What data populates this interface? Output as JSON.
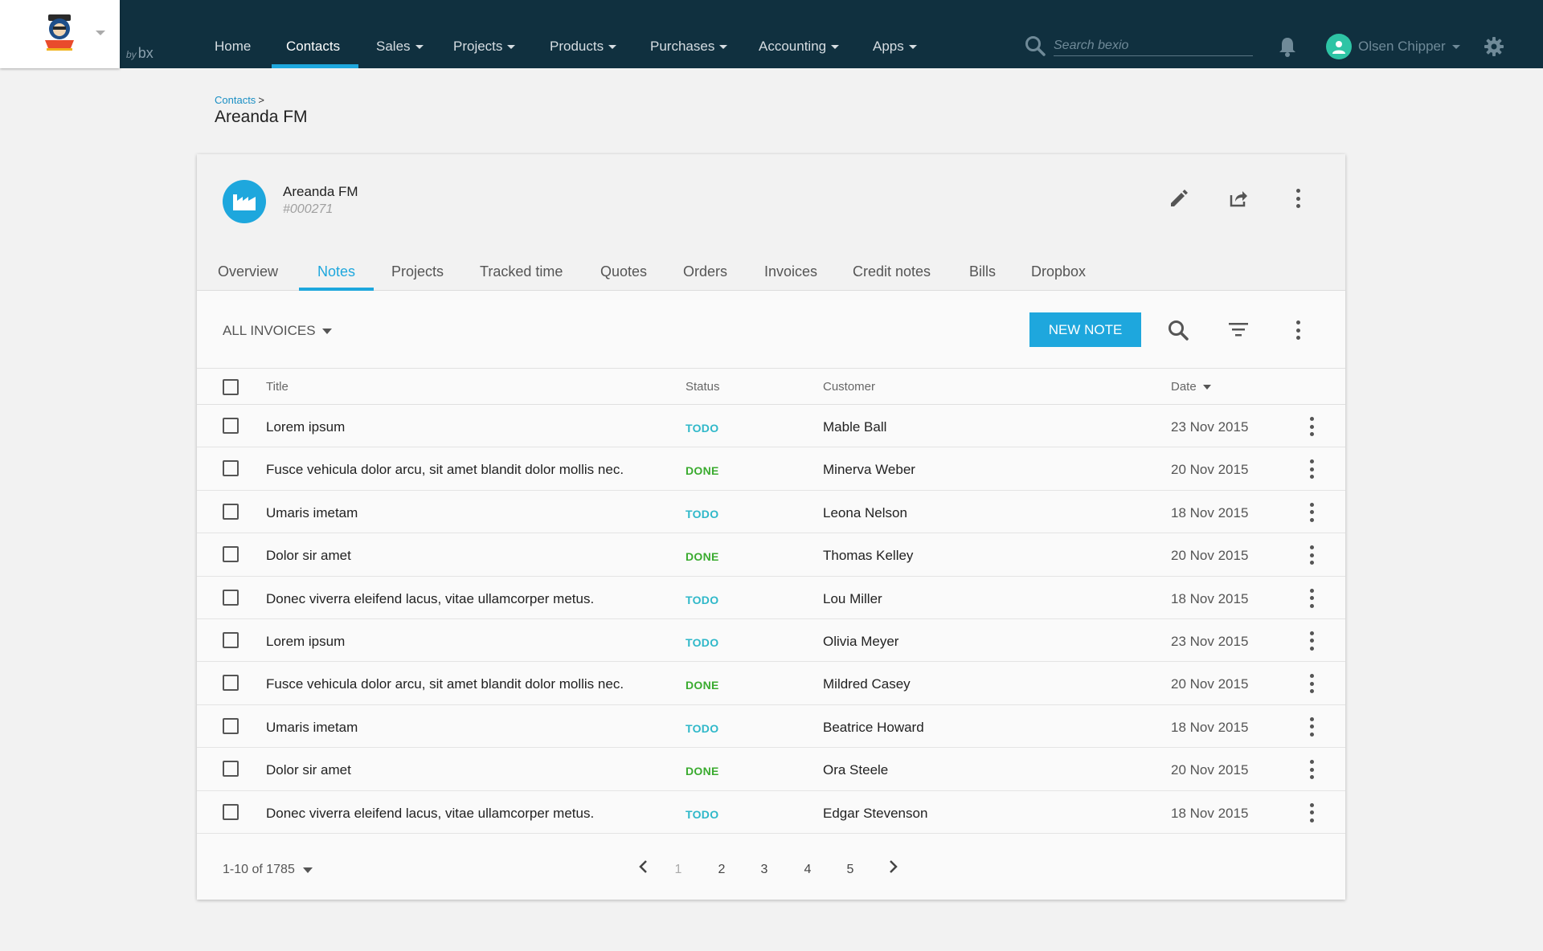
{
  "brand": {
    "by_text": "by",
    "bx_text": "bx"
  },
  "nav": {
    "home": "Home",
    "contacts": "Contacts",
    "sales": "Sales",
    "projects": "Projects",
    "products": "Products",
    "purchases": "Purchases",
    "accounting": "Accounting",
    "apps": "Apps",
    "active": "Contacts"
  },
  "search": {
    "placeholder": "Search bexio",
    "value": ""
  },
  "user": {
    "name": "Olsen Chipper"
  },
  "breadcrumb": {
    "parent": "Contacts",
    "separator": ">"
  },
  "page_title": "Areanda FM",
  "contact": {
    "name": "Areanda FM",
    "id": "#000271"
  },
  "tabs": [
    "Overview",
    "Notes",
    "Projects",
    "Tracked time",
    "Quotes",
    "Orders",
    "Invoices",
    "Credit notes",
    "Bills",
    "Dropbox"
  ],
  "active_tab": "Notes",
  "toolbar": {
    "filter_label": "ALL INVOICES",
    "new_note_label": "NEW NOTE"
  },
  "table": {
    "headers": {
      "title": "Title",
      "status": "Status",
      "customer": "Customer",
      "date": "Date"
    },
    "rows": [
      {
        "title": "Lorem ipsum",
        "status": "TODO",
        "customer": "Mable Ball",
        "date": "23 Nov 2015"
      },
      {
        "title": "Fusce vehicula dolor arcu, sit amet blandit dolor mollis nec.",
        "status": "DONE",
        "customer": "Minerva Weber",
        "date": "20 Nov 2015"
      },
      {
        "title": "Umaris imetam",
        "status": "TODO",
        "customer": "Leona Nelson",
        "date": "18 Nov 2015"
      },
      {
        "title": "Dolor sir amet",
        "status": "DONE",
        "customer": "Thomas Kelley",
        "date": "20 Nov 2015"
      },
      {
        "title": "Donec viverra eleifend lacus, vitae ullamcorper metus.",
        "status": "TODO",
        "customer": "Lou Miller",
        "date": "18 Nov 2015"
      },
      {
        "title": "Lorem ipsum",
        "status": "TODO",
        "customer": "Olivia Meyer",
        "date": "23 Nov 2015"
      },
      {
        "title": "Fusce vehicula dolor arcu, sit amet blandit dolor mollis nec.",
        "status": "DONE",
        "customer": "Mildred Casey",
        "date": "20 Nov 2015"
      },
      {
        "title": "Umaris imetam",
        "status": "TODO",
        "customer": "Beatrice Howard",
        "date": "18 Nov 2015"
      },
      {
        "title": "Dolor sir amet",
        "status": "DONE",
        "customer": "Ora Steele",
        "date": "20 Nov 2015"
      },
      {
        "title": "Donec viverra eleifend lacus, vitae ullamcorper metus.",
        "status": "TODO",
        "customer": "Edgar Stevenson",
        "date": "18 Nov 2015"
      }
    ]
  },
  "pagination": {
    "range_label": "1-10 of 1785",
    "pages": [
      "1",
      "2",
      "3",
      "4",
      "5"
    ],
    "current_page": "1"
  },
  "colors": {
    "topbar": "#10303f",
    "accent": "#1ea7dd",
    "status_todo": "#2fb8c9",
    "status_done": "#3aab2f",
    "avatar": "#2ec4a5"
  },
  "icons": {
    "logo": "olsens-logo-icon",
    "search": "search-icon",
    "bell": "bell-icon",
    "user": "user-avatar-icon",
    "settings": "gear-icon",
    "company": "factory-icon",
    "edit": "pencil-icon",
    "share": "share-icon",
    "more": "more-vertical-icon",
    "filter": "filter-icon",
    "prev": "chevron-left-icon",
    "next": "chevron-right-icon"
  }
}
